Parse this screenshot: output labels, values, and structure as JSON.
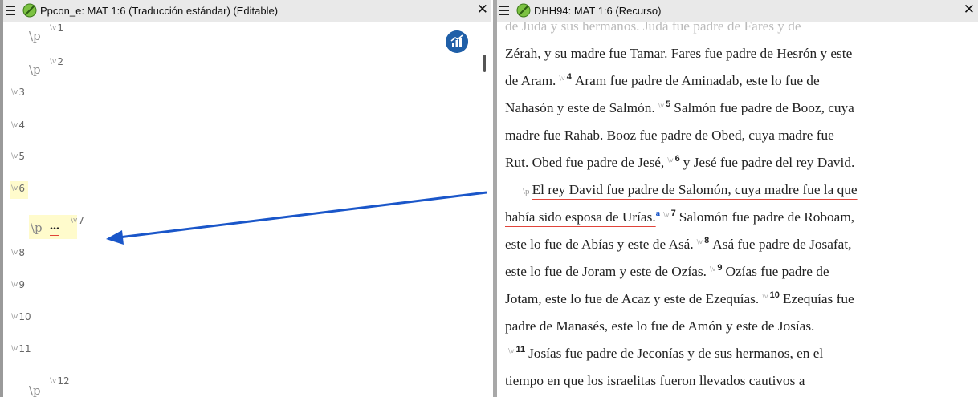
{
  "left": {
    "title": "Ppcon_e: MAT 1:6 (Traducción estándar) (Editable)",
    "close": "✕",
    "markers": [
      {
        "p": "\\p",
        "v": "1"
      },
      {
        "p": "\\p",
        "v": "2"
      },
      {
        "v": "3"
      },
      {
        "v": "4"
      },
      {
        "v": "5"
      },
      {
        "v": "6"
      },
      {
        "p": "\\p",
        "text": "...",
        "v": "7"
      },
      {
        "v": "8"
      },
      {
        "v": "9"
      },
      {
        "v": "10"
      },
      {
        "v": "11"
      },
      {
        "p": "\\p",
        "v": "12"
      }
    ]
  },
  "right": {
    "title": "DHH94: MAT 1:6 (Recurso)",
    "close": "✕",
    "lines": {
      "l0": "de Judá y sus hermanos.  Judá fue padre de Fares y de",
      "l1": "Zérah, y su madre fue Tamar. Fares fue padre de Hesrón y este",
      "l2a": "de Aram.",
      "v4": "4",
      "l2b": "Aram fue padre de Aminadab, este lo fue de",
      "l3a": "Nahasón y este de Salmón.",
      "v5": "5",
      "l3b": "Salmón fue padre de Booz, cuya",
      "l4": "madre fue Rahab. Booz fue padre de Obed, cuya madre fue",
      "l5a": "Rut. Obed fue padre de Jesé,",
      "v6": "6",
      "l5b": "y Jesé fue padre del rey David.",
      "l6": "El rey David fue padre de Salomón, cuya madre fue la que",
      "l7a": "había sido esposa de Urías.",
      "fn": "a",
      "v7": "7",
      "l7b": "Salomón fue padre de Roboam,",
      "l8a": "este lo fue de Abías y este de Asá.",
      "v8": "8",
      "l8b": "Asá fue padre de Josafat,",
      "l9a": "este lo fue de Joram y este de Ozías.",
      "v9": "9",
      "l9b": "Ozías fue padre de",
      "l10a": "Jotam, este lo fue de Acaz y este de Ezequías.",
      "v10": "10",
      "l10b": "Ezequías fue",
      "l11": "padre de Manasés, este lo fue de Amón y este de Josías.",
      "v11": "11",
      "l12b": "Josías fue padre de Jeconías y de sus hermanos, en el",
      "l13": "tiempo en que los israelitas fueron llevados cautivos a"
    }
  },
  "colors": {
    "arrow": "#1a56c9",
    "highlight": "#fffbcc",
    "spell": "#e0443a"
  }
}
